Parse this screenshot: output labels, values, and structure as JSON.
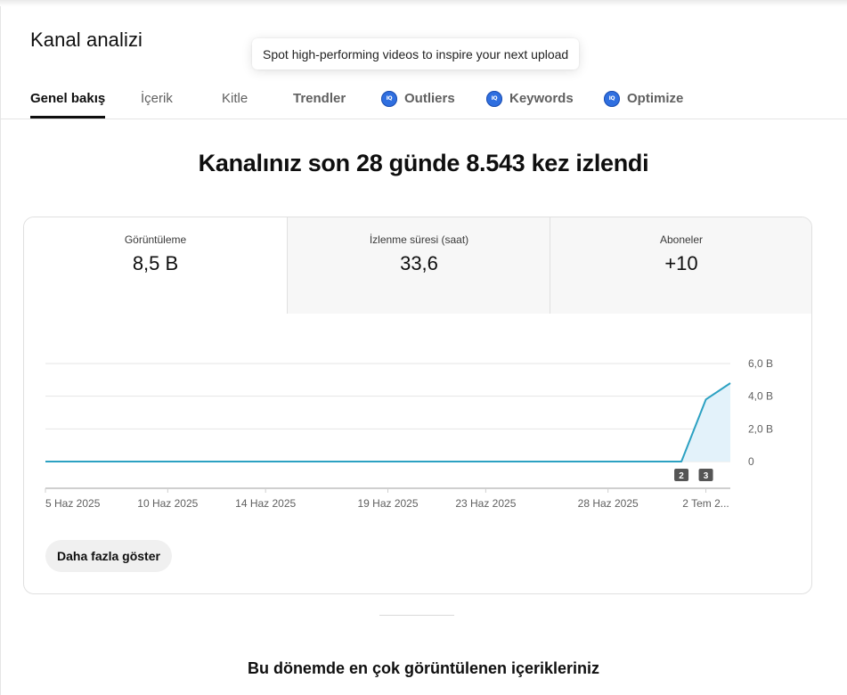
{
  "page": {
    "title": "Kanal analizi"
  },
  "tooltip": {
    "text": "Spot high-performing videos to inspire your next upload"
  },
  "tabs": [
    {
      "label": "Genel bakış",
      "active": true
    },
    {
      "label": "İçerik"
    },
    {
      "label": "Kitle"
    },
    {
      "label": "Trendler"
    },
    {
      "label": "Outliers",
      "icon": "vidiq-icon"
    },
    {
      "label": "Keywords",
      "icon": "vidiq-icon"
    },
    {
      "label": "Optimize",
      "icon": "vidiq-icon"
    }
  ],
  "vidiq_icon_text": "IQ",
  "headline": "Kanalınız son 28 günde 8.543 kez izlendi",
  "metrics": [
    {
      "label": "Görüntüleme",
      "value": "8,5 B"
    },
    {
      "label": "İzlenme süresi (saat)",
      "value": "33,6"
    },
    {
      "label": "Aboneler",
      "value": "+10"
    }
  ],
  "chart_data": {
    "type": "line",
    "x_labels": [
      "5 Haz 2025",
      "10 Haz 2025",
      "14 Haz 2025",
      "19 Haz 2025",
      "23 Haz 2025",
      "28 Haz 2025",
      "2 Tem 2..."
    ],
    "y_ticks": [
      "6,0 B",
      "4,0 B",
      "2,0 B",
      "0"
    ],
    "ylim": [
      0,
      6000
    ],
    "series": [
      {
        "values": [
          0,
          0,
          0,
          0,
          0,
          0,
          0,
          0,
          0,
          0,
          0,
          0,
          0,
          0,
          0,
          0,
          0,
          0,
          0,
          0,
          0,
          0,
          0,
          0,
          0,
          0,
          0,
          3800,
          4800
        ]
      }
    ],
    "markers": [
      {
        "label": "2",
        "index": 26
      },
      {
        "label": "3",
        "index": 27
      }
    ],
    "line_color": "#2ca1c2",
    "fill_color": "#e3f2fa"
  },
  "more_button": {
    "label": "Daha fazla göster"
  },
  "section": {
    "title": "Bu dönemde en çok görüntülenen içerikleriniz"
  }
}
